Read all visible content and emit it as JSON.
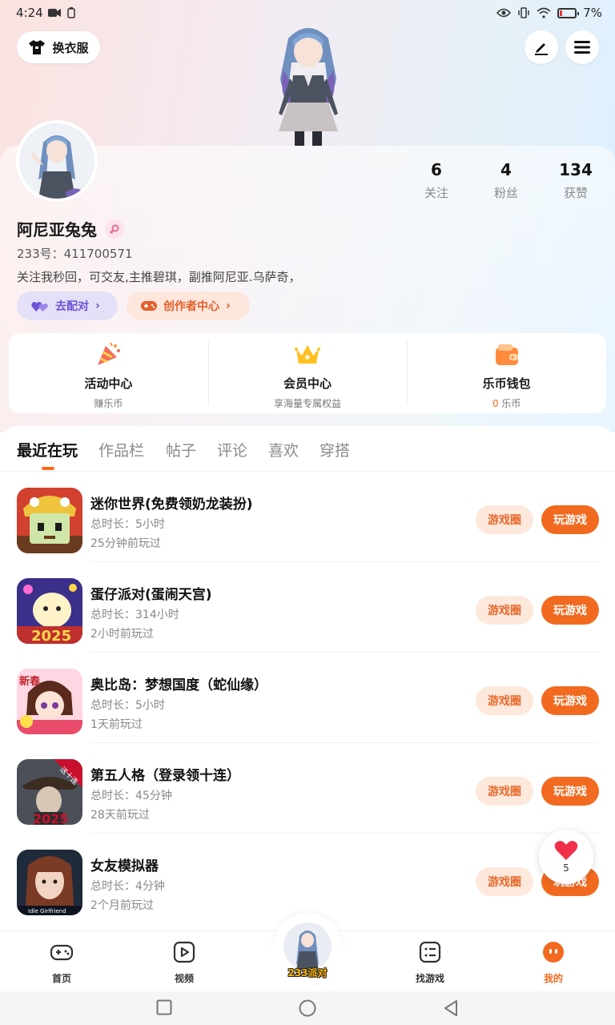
{
  "status_bar": {
    "time": "4:24",
    "battery_percent": "7%"
  },
  "header": {
    "outfit_label": "换衣服"
  },
  "profile": {
    "name": "阿尼亚兔兔",
    "uid": "233号：411700571",
    "bio": "关注我秒回，可交友,主推碧琪，副推阿尼亚.乌萨奇，",
    "stats": [
      {
        "value": "6",
        "label": "关注"
      },
      {
        "value": "4",
        "label": "粉丝"
      },
      {
        "value": "134",
        "label": "获赞"
      }
    ],
    "match_label": "去配对",
    "creator_label": "创作者中心"
  },
  "features": [
    {
      "title": "活动中心",
      "sub": "赚乐币"
    },
    {
      "title": "会员中心",
      "sub": "享海量专属权益"
    },
    {
      "title": "乐币钱包",
      "sub_value": "0",
      "sub_unit": "乐币"
    }
  ],
  "tabs": [
    "最近在玩",
    "作品栏",
    "帖子",
    "评论",
    "喜欢",
    "穿搭"
  ],
  "games": [
    {
      "title": "迷你世界(免费领奶龙装扮)",
      "duration": "总时长：5小时",
      "last_played": "25分钟前玩过"
    },
    {
      "title": "蛋仔派对(蛋闹天宫)",
      "duration": "总时长：314小时",
      "last_played": "2小时前玩过"
    },
    {
      "title": "奥比岛：梦想国度（蛇仙缘）",
      "duration": "总时长：5小时",
      "last_played": "1天前玩过"
    },
    {
      "title": "第五人格（登录领十连）",
      "duration": "总时长：45分钟",
      "last_played": "28天前玩过"
    },
    {
      "title": "女友模拟器",
      "duration": "总时长：4分钟",
      "last_played": "2个月前玩过"
    }
  ],
  "game_buttons": {
    "circle": "游戏圈",
    "play": "玩游戏"
  },
  "game_icon_texts": {
    "g2": "2025",
    "g3": "新春",
    "g4_ribbon": "送十连",
    "g4_year": "2025",
    "g5": "Idle Girlfriend"
  },
  "floating_heart_count": "5",
  "bottom_nav": {
    "home": "首页",
    "video": "视频",
    "center": "233派对",
    "find": "找游戏",
    "me": "我的"
  },
  "colors": {
    "accent": "#f26a1f",
    "match": "#6d53d8"
  }
}
